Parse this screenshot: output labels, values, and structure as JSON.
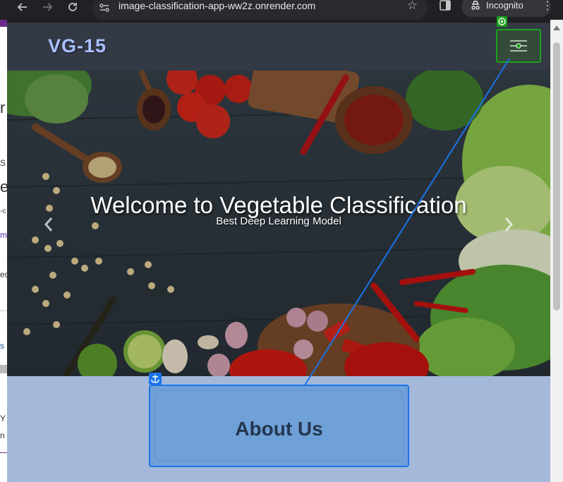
{
  "browser": {
    "url": "image-classification-app-ww2z.onrender.com",
    "profile_label": "Incognito",
    "icons": [
      "back-arrow-icon",
      "forward-arrow-icon",
      "reload-icon",
      "site-info-icon",
      "bookmark-star-icon",
      "side-panel-icon",
      "incognito-icon",
      "kebab-menu-icon"
    ]
  },
  "background_page": {
    "fragments": [
      "r",
      "S",
      "e",
      "-c",
      "m",
      "ec",
      "s",
      "Y",
      "n"
    ]
  },
  "navbar": {
    "brand": "VG-15",
    "toggler_icon": "menu-toggler-icon"
  },
  "hero": {
    "title": "Welcome to Vegetable Classification",
    "subtitle": "Best Deep Learning Model",
    "prev_icon": "chevron-left-icon",
    "next_icon": "chevron-right-icon"
  },
  "about": {
    "title": "About Us"
  },
  "annotations": {
    "target_badge_icon": "target-icon",
    "anchor_badge_icon": "anchor-icon",
    "colors": {
      "target": "#1ba11b",
      "anchor": "#1a73e8"
    }
  }
}
